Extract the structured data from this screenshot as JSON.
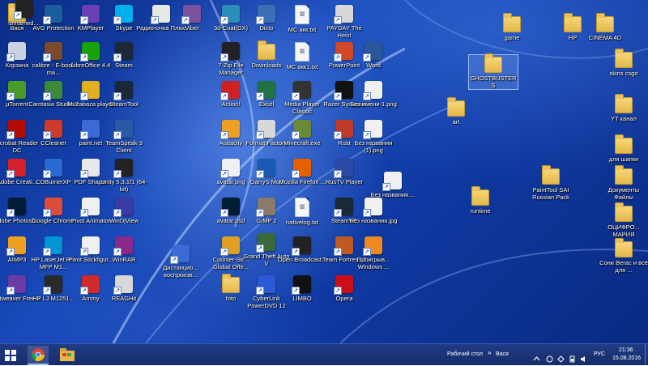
{
  "desktop": {
    "icons": [
      {
        "label": "Вася",
        "icon": "user-folder-icon",
        "color": "#3a7bd5"
      },
      {
        "label": "AVG Protection",
        "icon": "avg-icon",
        "color": "#1b5e9e"
      },
      {
        "label": "KMPlayer",
        "icon": "kmplayer-icon",
        "color": "#6a3fb5"
      },
      {
        "label": "Skype",
        "icon": "skype-icon",
        "color": "#00aff0"
      },
      {
        "label": "Радиоточка Плюс",
        "icon": "radio-icon",
        "color": "#e8e8e8"
      },
      {
        "label": "Viber",
        "icon": "viber-icon",
        "color": "#7b519d"
      },
      {
        "label": "3d-Coat(DX)",
        "icon": "3dcoat-icon",
        "color": "#2a8fb8"
      },
      {
        "label": "Dicto",
        "icon": "dicto-icon",
        "color": "#3a6fb5"
      },
      {
        "label": "MC акк.txt",
        "icon": "text-file-icon",
        "color": "#f4f6fa"
      },
      {
        "label": "PAYDAY The Heist",
        "icon": "payday-icon",
        "color": "#d8d8d8"
      },
      {
        "label": "game",
        "icon": "folder-icon",
        "color": "#f5d77a"
      },
      {
        "label": "HP",
        "icon": "folder-icon",
        "color": "#f5d77a"
      },
      {
        "label": "CINEMA 4D",
        "icon": "folder-icon",
        "color": "#f5d77a"
      },
      {
        "label": "Корзина",
        "icon": "recycle-bin-icon",
        "color": "#c8d2e2"
      },
      {
        "label": "calibre - E-book ma...",
        "icon": "calibre-icon",
        "color": "#7a4a2a"
      },
      {
        "label": "LibreOffice 4.4",
        "icon": "libreoffice-icon",
        "color": "#18a303"
      },
      {
        "label": "Steam",
        "icon": "steam-icon",
        "color": "#1b2838"
      },
      {
        "label": "7-Zip File Manager",
        "icon": "7zip-icon",
        "color": "#222222"
      },
      {
        "label": "Downloads",
        "icon": "downloads-icon",
        "color": "#f5d77a"
      },
      {
        "label": "MC акк1.txt",
        "icon": "text-file-icon",
        "color": "#f4f6fa"
      },
      {
        "label": "PowerPoint",
        "icon": "powerpoint-icon",
        "color": "#d24726"
      },
      {
        "label": "Word",
        "icon": "word-icon",
        "color": "#2b579a"
      },
      {
        "label": "GHOSTBUSTERS",
        "icon": "folder-icon",
        "color": "#f5d77a"
      },
      {
        "label": "skins csgo",
        "icon": "folder-icon",
        "color": "#f5d77a"
      },
      {
        "label": "µTorrent",
        "icon": "utorrent-icon",
        "color": "#4a9a2a"
      },
      {
        "label": "Camtasia Studio 7",
        "icon": "camtasia-icon",
        "color": "#3a8a3a"
      },
      {
        "label": "Muzabaza player",
        "icon": "muzabaza-icon",
        "color": "#e0b020"
      },
      {
        "label": "SteamTool",
        "icon": "steamtool-icon",
        "color": "#1b2838"
      },
      {
        "label": "Action!",
        "icon": "action-icon",
        "color": "#d02020"
      },
      {
        "label": "Excel",
        "icon": "excel-icon",
        "color": "#217346"
      },
      {
        "label": "Media Player Classic",
        "icon": "media-player-icon",
        "color": "#333333"
      },
      {
        "label": "Razer Synapse",
        "icon": "razer-icon",
        "color": "#111111"
      },
      {
        "label": "Без имени-1.png",
        "icon": "image-file-icon",
        "color": "#f0f0f0"
      },
      {
        "label": "art",
        "icon": "folder-icon",
        "color": "#f5d77a"
      },
      {
        "label": "YT канал",
        "icon": "folder-icon",
        "color": "#f5d77a"
      },
      {
        "label": "Acrobat Reader DC",
        "icon": "acrobat-icon",
        "color": "#b30b00"
      },
      {
        "label": "CCleaner",
        "icon": "ccleaner-icon",
        "color": "#d03a2a"
      },
      {
        "label": "paint.net",
        "icon": "paintnet-icon",
        "color": "#3a6ad5"
      },
      {
        "label": "TeamSpeak 3 Client",
        "icon": "teamspeak-icon",
        "color": "#2a5aa5"
      },
      {
        "label": "Audacity",
        "icon": "audacity-icon",
        "color": "#f0a020"
      },
      {
        "label": "Format Factory",
        "icon": "format-factory-icon",
        "color": "#d8d8d8"
      },
      {
        "label": "Minecraft.exe",
        "icon": "minecraft-icon",
        "color": "#6a8a3a"
      },
      {
        "label": "Rust",
        "icon": "rust-icon",
        "color": "#c03a2a"
      },
      {
        "label": "Без названия (1).png",
        "icon": "image-file-icon",
        "color": "#f0f0f0"
      },
      {
        "label": "для шапки",
        "icon": "folder-icon",
        "color": "#f5d77a"
      },
      {
        "label": "Adobe Creati...",
        "icon": "adobe-cc-icon",
        "color": "#d4202a"
      },
      {
        "label": "CDBurnerXP",
        "icon": "cdburner-icon",
        "color": "#2a6ad5"
      },
      {
        "label": "PDF Shaper",
        "icon": "pdf-shaper-icon",
        "color": "#e8e8e8"
      },
      {
        "label": "Unity 5.3.1f1 (64-bit)",
        "icon": "unity-icon",
        "color": "#222222"
      },
      {
        "label": "avatar.png",
        "icon": "image-file-icon",
        "color": "#f0f0f0"
      },
      {
        "label": "Garry's Mod",
        "icon": "gmod-icon",
        "color": "#1a5ab5"
      },
      {
        "label": "Mozilla Firefox ...",
        "icon": "firefox-icon",
        "color": "#e66000"
      },
      {
        "label": "RusTV Player",
        "icon": "rustv-icon",
        "color": "#2a4aa5"
      },
      {
        "label": "Без названия....",
        "icon": "image-file-icon",
        "color": "#f0f0f0"
      },
      {
        "label": "PaintTool SAI Russian Pack",
        "icon": "folder-icon",
        "color": "#f5d77a"
      },
      {
        "label": "Документы Файлы",
        "icon": "folder-icon",
        "color": "#f5d77a"
      },
      {
        "label": "Adobe Photosh...",
        "icon": "photoshop-icon",
        "color": "#001d34"
      },
      {
        "label": "Google Chrome",
        "icon": "chrome-icon",
        "color": "#dd4b39"
      },
      {
        "label": "Pivot Animator",
        "icon": "pivot-icon",
        "color": "#f0f0f0"
      },
      {
        "label": "WinDjView",
        "icon": "windjview-icon",
        "color": "#3a3aa5"
      },
      {
        "label": "avatar.psd",
        "icon": "psd-file-icon",
        "color": "#001d34"
      },
      {
        "label": "GIMP 2",
        "icon": "gimp-icon",
        "color": "#8a7a6a"
      },
      {
        "label": "nativelog.txt",
        "icon": "text-file-icon",
        "color": "#f4f6fa"
      },
      {
        "label": "SteamVR",
        "icon": "steamvr-icon",
        "color": "#1b2838"
      },
      {
        "label": "Без названия.jpg",
        "icon": "image-file-icon",
        "color": "#f0f0f0"
      },
      {
        "label": "runtime",
        "icon": "folder-icon",
        "color": "#f5d77a"
      },
      {
        "label": "ОЦИФРО... МАРИЯ",
        "icon": "folder-icon",
        "color": "#f5d77a"
      },
      {
        "label": "AIMP3",
        "icon": "aimp-icon",
        "color": "#f0a020"
      },
      {
        "label": "HP LaserJet Pro MFP M1...",
        "icon": "hp-icon",
        "color": "#0096d6"
      },
      {
        "label": "Pivot Stickfigur...",
        "icon": "pivot-icon",
        "color": "#f0f0f0"
      },
      {
        "label": "WinRAR",
        "icon": "winrar-icon",
        "color": "#8a2a8a"
      },
      {
        "label": "Дистанцио... воспроизв...",
        "icon": "remote-play-icon",
        "color": "#3a6ad5"
      },
      {
        "label": "Counter-Str... Global Offe...",
        "icon": "csgo-icon",
        "color": "#e0a020"
      },
      {
        "label": "Grand Theft Auto V",
        "icon": "gta-icon",
        "color": "#3a6a3a"
      },
      {
        "label": "Open Broadcast...",
        "icon": "obs-icon",
        "color": "#222222"
      },
      {
        "label": "Team Fortress 2",
        "icon": "tf2-icon",
        "color": "#c05a20"
      },
      {
        "label": "Проигрыв... Windows ...",
        "icon": "windows-media-icon",
        "color": "#f08a20"
      },
      {
        "label": "Сони Вегас и всё для ...",
        "icon": "folder-icon",
        "color": "#f5d77a"
      },
      {
        "label": "Artweaver Free 4",
        "icon": "artweaver-icon",
        "color": "#6a3aa5"
      },
      {
        "label": "HP LJ M1251...",
        "icon": "hp-printer-icon",
        "color": "#2a2a2a"
      },
      {
        "label": "Ammy",
        "icon": "ammy-icon",
        "color": "#d02a2a"
      },
      {
        "label": "REAGHit",
        "icon": "reaghit-icon",
        "color": "#d8d8d8"
      },
      {
        "label": "foto",
        "icon": "folder-icon",
        "color": "#f5d77a"
      },
      {
        "label": "CyberLink PowerDVD 12",
        "icon": "powerdvd-icon",
        "color": "#2a5ad5"
      },
      {
        "label": "LIMBO",
        "icon": "limbo-icon",
        "color": "#111111"
      },
      {
        "label": "Opera",
        "icon": "opera-icon",
        "color": "#cc0f16"
      },
      {
        "label": "unnamed....",
        "icon": "image-file-icon",
        "color": "#222222"
      }
    ]
  },
  "taskbar": {
    "pinned": [
      {
        "name": "Google Chrome",
        "icon": "chrome-icon"
      },
      {
        "name": "File Explorer",
        "icon": "explorer-icon"
      }
    ],
    "toolbar_label": "Рабочий стол",
    "user_label": "Вася",
    "language": "РУС",
    "time": "21:36",
    "date": "15.08.2016"
  }
}
